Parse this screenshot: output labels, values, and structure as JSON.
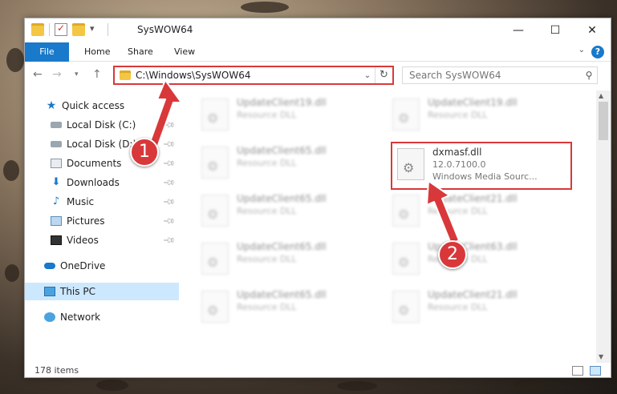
{
  "window": {
    "title": "SysWOW64",
    "controls": {
      "minimize": "—",
      "maximize": "☐",
      "close": "✕"
    }
  },
  "ribbon": {
    "tabs": [
      "File",
      "Home",
      "Share",
      "View"
    ],
    "help": "?"
  },
  "address_bar": {
    "path": "C:\\Windows\\SysWOW64"
  },
  "search": {
    "placeholder": "Search SysWOW64"
  },
  "sidebar": {
    "items": [
      {
        "label": "Quick access",
        "icon": "star-icon"
      },
      {
        "label": "Local Disk (C:)",
        "icon": "disk-icon",
        "pinned": true
      },
      {
        "label": "Local Disk (D:)",
        "icon": "disk-icon",
        "pinned": true
      },
      {
        "label": "Documents",
        "icon": "documents-icon",
        "pinned": true
      },
      {
        "label": "Downloads",
        "icon": "download-icon",
        "pinned": true
      },
      {
        "label": "Music",
        "icon": "music-icon",
        "pinned": true
      },
      {
        "label": "Pictures",
        "icon": "pictures-icon",
        "pinned": true
      },
      {
        "label": "Videos",
        "icon": "videos-icon",
        "pinned": true
      },
      {
        "label": "OneDrive",
        "icon": "cloud-icon"
      },
      {
        "label": "This PC",
        "icon": "pc-icon",
        "selected": true
      },
      {
        "label": "Network",
        "icon": "network-icon"
      }
    ]
  },
  "files": [
    {
      "name": "UpdateClient19.dll",
      "desc": "Resource DLL"
    },
    {
      "name": "UpdateClient19.dll",
      "desc": "Resource DLL"
    },
    {
      "name": "UpdateClient65.dll",
      "desc": "Resource DLL"
    },
    {
      "name": "dxmasf.dll",
      "version": "12.0.7100.0",
      "desc": "Windows Media Sourc..."
    },
    {
      "name": "UpdateClient65.dll",
      "desc": "Resource DLL"
    },
    {
      "name": "UpdateClient21.dll",
      "desc": "Resource DLL"
    },
    {
      "name": "UpdateClient65.dll",
      "desc": "Resource DLL"
    },
    {
      "name": "UpdateClient63.dll",
      "desc": "Resource DLL"
    },
    {
      "name": "UpdateClient65.dll",
      "desc": "Resource DLL"
    },
    {
      "name": "UpdateClient21.dll",
      "desc": "Resource DLL"
    }
  ],
  "status": {
    "item_count": "178 items"
  },
  "annotations": {
    "step1": "1",
    "step2": "2",
    "color": "#d9383a"
  }
}
